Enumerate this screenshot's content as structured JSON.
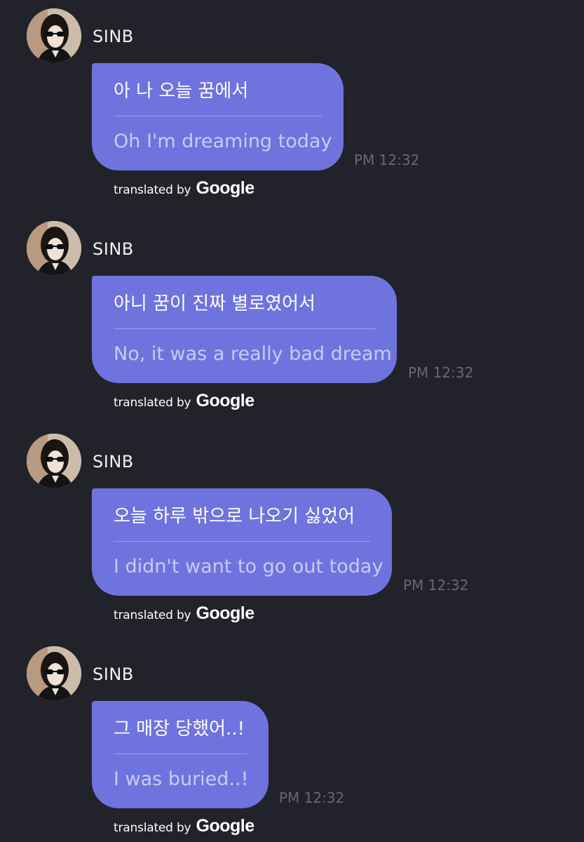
{
  "messages": [
    {
      "sender": "SINB",
      "original": "아 나 오늘 꿈에서",
      "translation": "Oh I'm dreaming today",
      "time": "PM 12:32",
      "credit_text": "translated by",
      "credit_brand": "Google"
    },
    {
      "sender": "SINB",
      "original": "아니 꿈이 진짜 별로였어서",
      "translation": "No, it was a really bad dream",
      "time": "PM 12:32",
      "credit_text": "translated by",
      "credit_brand": "Google"
    },
    {
      "sender": "SINB",
      "original": "오늘 하루 밖으로 나오기 싫었어",
      "translation": "I didn't want to go out today",
      "time": "PM 12:32",
      "credit_text": "translated by",
      "credit_brand": "Google"
    },
    {
      "sender": "SINB",
      "original": "그 매장 당했어..!",
      "translation": "I was buried..!",
      "time": "PM 12:32",
      "credit_text": "translated by",
      "credit_brand": "Google"
    }
  ],
  "colors": {
    "background": "#22222b",
    "bubble": "#6f73dd",
    "timestamp": "#676873"
  },
  "icons": {
    "avatar": "profile-photo"
  }
}
